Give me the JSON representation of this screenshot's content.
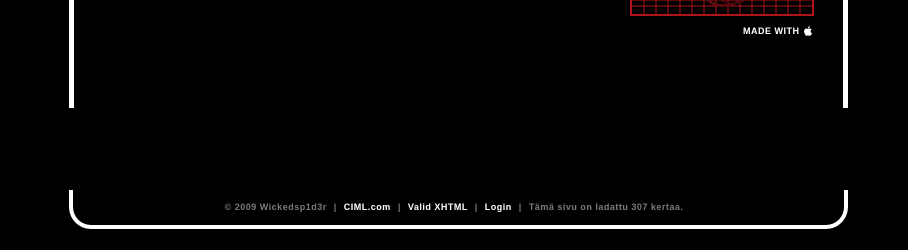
{
  "header": {
    "made_with_label": "MADE WITH",
    "made_with_icon": "apple-icon"
  },
  "footer": {
    "copyright": "© 2009 Wickedsp1d3r",
    "separator": "|",
    "links": [
      {
        "label": "CIML.com"
      },
      {
        "label": "Valid XHTML"
      },
      {
        "label": "Login"
      }
    ],
    "counter_text": "Tämä sivu on ladattu 307 kertaa."
  },
  "colors": {
    "background": "#000000",
    "frame": "#ffffff",
    "accent_red": "#b0131c",
    "muted_text": "#7a7a7a",
    "link_text": "#ffffff"
  }
}
